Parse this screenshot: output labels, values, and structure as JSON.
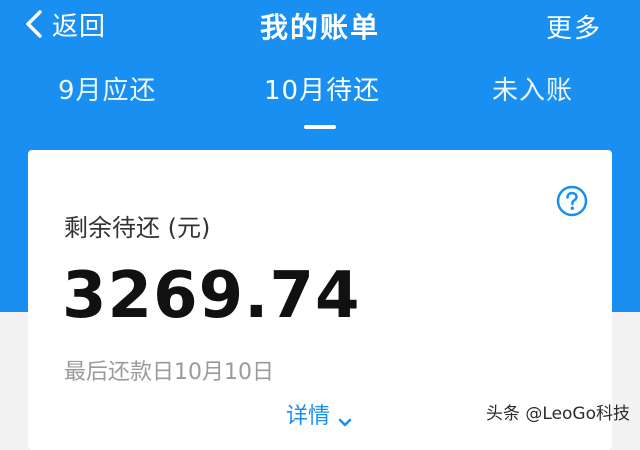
{
  "header": {
    "back_label": "返回",
    "title": "我的账单",
    "more_label": "更多"
  },
  "tabs": [
    {
      "label": "9月应还",
      "active": false
    },
    {
      "label": "10月待还",
      "active": true
    },
    {
      "label": "未入账",
      "active": false
    }
  ],
  "bill": {
    "remaining_label": "剩余待还 (元)",
    "amount": "3269.74",
    "due_text": "最后还款日10月10日",
    "detail_label": "详情"
  },
  "watermark": "头条 @LeoGo科技",
  "colors": {
    "brand_blue": "#1a8ff2",
    "card_bg": "#ffffff",
    "page_bg": "#f2f2f2",
    "amount_text": "#111111",
    "muted_text": "#9a9a9a"
  },
  "icons": {
    "back": "chevron-left-icon",
    "help": "question-circle-icon",
    "detail": "chevron-down-icon"
  }
}
